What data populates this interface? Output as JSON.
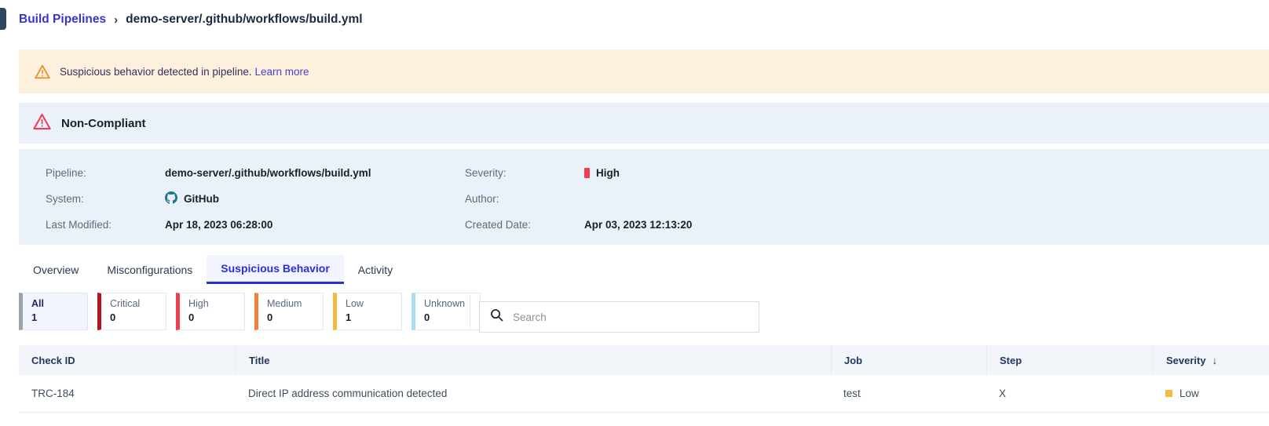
{
  "breadcrumb": {
    "root": "Build Pipelines",
    "separator": "›",
    "current": "demo-server/.github/workflows/build.yml"
  },
  "alert_banner": {
    "icon": "warning-triangle-icon",
    "message": "Suspicious behavior detected in pipeline.",
    "link_label": "Learn more",
    "background": "#fdf0dc",
    "icon_color": "#ef8c1e"
  },
  "compliance": {
    "icon": "alert-triangle-icon",
    "status": "Non-Compliant",
    "background": "#eaf1f8",
    "icon_color": "#ef3e5c"
  },
  "details": {
    "rows": [
      {
        "left_label": "Pipeline:",
        "left_value": "demo-server/.github/workflows/build.yml",
        "right_label": "Severity:",
        "right_value": "High",
        "right_badge_color": "#ee3e52"
      },
      {
        "left_label": "System:",
        "left_value": "GitHub",
        "left_icon": "github-icon",
        "right_label": "Author:",
        "right_value": ""
      },
      {
        "left_label": "Last Modified:",
        "left_value": "Apr 18, 2023 06:28:00",
        "right_label": "Created Date:",
        "right_value": "Apr 03, 2023 12:13:20"
      }
    ]
  },
  "tabs": [
    {
      "label": "Overview",
      "active": false
    },
    {
      "label": "Misconfigurations",
      "active": false
    },
    {
      "label": "Suspicious Behavior",
      "active": true
    },
    {
      "label": "Activity",
      "active": false
    }
  ],
  "filters": [
    {
      "label": "All",
      "count": "1",
      "bar_color": "#9aa3ad",
      "selected": true
    },
    {
      "label": "Critical",
      "count": "0",
      "bar_color": "#b4121f",
      "selected": false
    },
    {
      "label": "High",
      "count": "0",
      "bar_color": "#ee3e52",
      "selected": false
    },
    {
      "label": "Medium",
      "count": "0",
      "bar_color": "#f0803c",
      "selected": false
    },
    {
      "label": "Low",
      "count": "1",
      "bar_color": "#f5b93e",
      "selected": false
    },
    {
      "label": "Unknown",
      "count": "0",
      "bar_color": "#a9dcec",
      "selected": false
    }
  ],
  "search": {
    "icon": "search-icon",
    "placeholder": "Search",
    "value": ""
  },
  "table": {
    "columns": [
      {
        "label": "Check ID",
        "sorted": false
      },
      {
        "label": "Title",
        "sorted": false
      },
      {
        "label": "Job",
        "sorted": false
      },
      {
        "label": "Step",
        "sorted": false
      },
      {
        "label": "Severity",
        "sorted": true,
        "sort_arrow": "↓"
      }
    ],
    "rows": [
      {
        "check_id": "TRC-184",
        "title": "Direct IP address communication detected",
        "job": "test",
        "step": "X",
        "severity": "Low",
        "severity_color": "#f5b93e"
      }
    ]
  },
  "theme": {
    "link_color": "#3a35c4",
    "active_tab_color": "#2b2fd6",
    "panel_background": "#eaf1f8"
  }
}
